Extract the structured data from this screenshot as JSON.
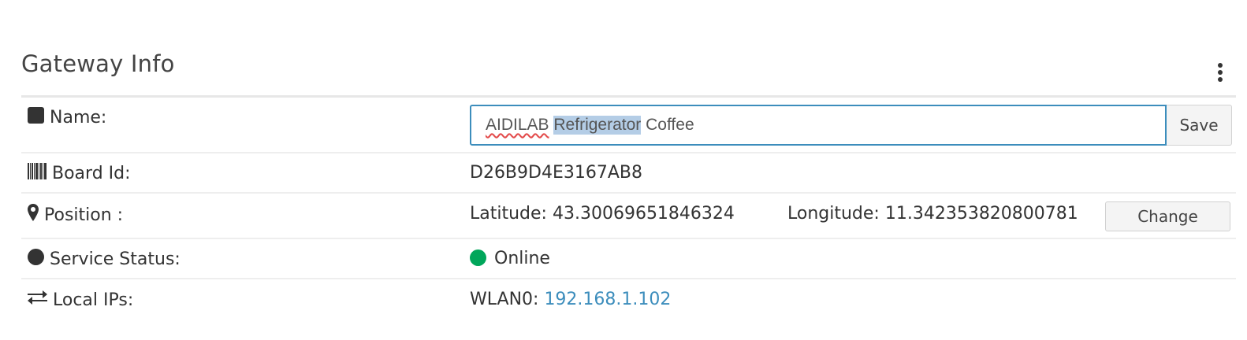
{
  "panel": {
    "title": "Gateway Info"
  },
  "rows": {
    "name": {
      "label": "Name:",
      "icon": "square-icon",
      "input_prefix": "AIDILAB",
      "input_selected": "Refrigerator",
      "input_suffix": "Coffee",
      "save_label": "Save"
    },
    "board_id": {
      "label": "Board Id:",
      "icon": "barcode-icon",
      "value": "D26B9D4E3167AB8"
    },
    "position": {
      "label": "Position :",
      "icon": "map-marker-icon",
      "latitude_label": "Latitude:",
      "latitude": "43.30069651846324",
      "longitude_label": "Longitude:",
      "longitude": "11.342353820800781",
      "change_label": "Change"
    },
    "service_status": {
      "label": "Service Status:",
      "icon": "circle-icon",
      "value": "Online",
      "status_color": "#00a65a"
    },
    "local_ips": {
      "label": "Local IPs:",
      "icon": "exchange-icon",
      "interface": "WLAN0:",
      "ip": "192.168.1.102"
    }
  },
  "colors": {
    "accent": "#3c8dbc",
    "online": "#00a65a",
    "selection": "#b4cde6"
  }
}
